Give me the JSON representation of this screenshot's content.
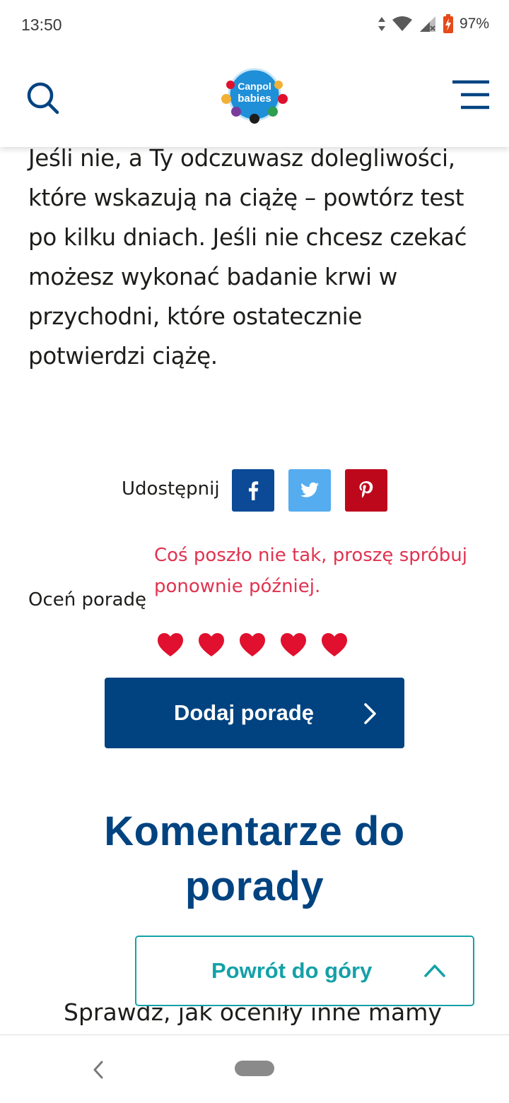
{
  "status_bar": {
    "time": "13:50",
    "battery": "97%",
    "icons": [
      "data-arrows-icon",
      "wifi-icon",
      "signal-icon",
      "battery-charging-icon"
    ]
  },
  "header": {
    "logo_text_line1": "Canpol",
    "logo_text_line2": "babies",
    "icons": [
      "search-icon",
      "menu-icon"
    ]
  },
  "article": {
    "paragraph_lines": [
      "Jeśli nie, a Ty odczuwasz dolegliwości,",
      "które wskazują na ciążę – powtórz test",
      "po kilku dniach. Jeśli nie chcesz czekać",
      "możesz wykonać badanie krwi w",
      "przychodni, które ostatecznie",
      "potwierdzi ciążę."
    ]
  },
  "share": {
    "label": "Udostępnij",
    "buttons": [
      {
        "name": "facebook",
        "color": "#0c4a97"
      },
      {
        "name": "twitter",
        "color": "#55acee"
      },
      {
        "name": "pinterest",
        "color": "#bd081c"
      }
    ]
  },
  "rating": {
    "label": "Oceń poradę",
    "error": "Coś poszło nie tak, proszę spróbuj ponownie później.",
    "hearts_count": 5,
    "heart_color": "#e0102e"
  },
  "add_tip_button": {
    "label": "Dodaj poradę"
  },
  "comments": {
    "heading": "Komentarze do porady",
    "subheading": "Sprawdź, jak oceniły inne mamy"
  },
  "back_to_top": {
    "label": "Powrót do góry"
  },
  "colors": {
    "primary": "#004380",
    "teal": "#14a1a8",
    "error": "#e03350"
  }
}
